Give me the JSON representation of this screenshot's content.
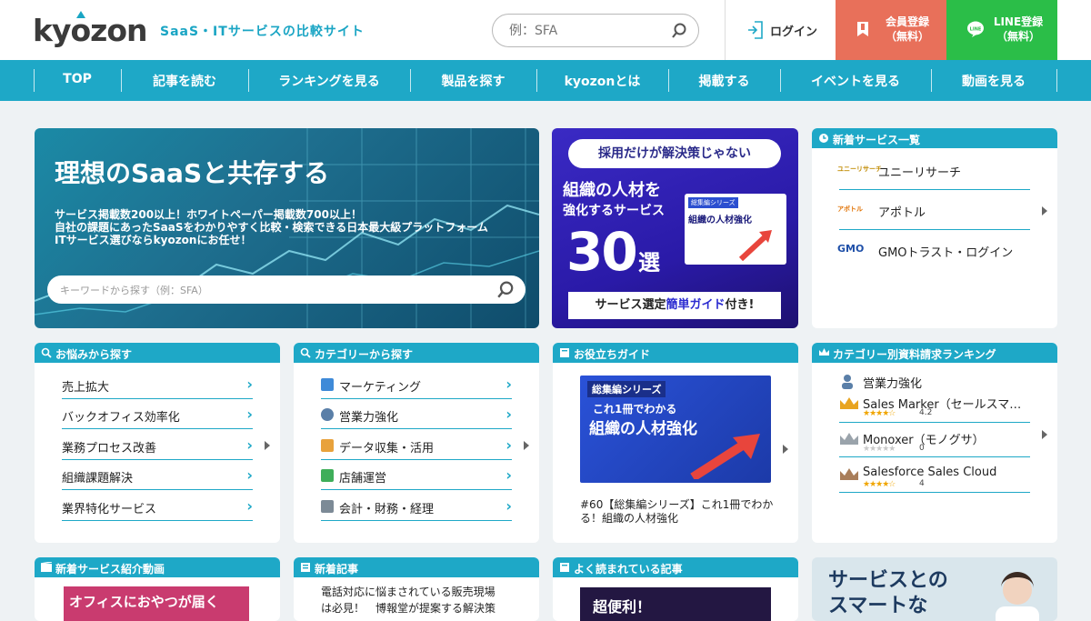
{
  "header": {
    "logo": "kyozon",
    "tagline": "SaaS・ITサービスの比較サイト",
    "search_placeholder": "例：SFA",
    "login_label": "ログイン",
    "member_label": "会員登録",
    "member_sub": "（無料）",
    "line_label": "LINE登録",
    "line_sub": "（無料）",
    "colors": {
      "accent": "#1ea8c7",
      "member": "#e8705a",
      "line": "#2bbe48"
    }
  },
  "nav": {
    "items": [
      "TOP",
      "記事を読む",
      "ランキングを見る",
      "製品を探す",
      "kyozonとは",
      "掲載する",
      "イベントを見る",
      "動画を見る"
    ]
  },
  "hero": {
    "title": "理想のSaaSと共存する",
    "desc1": "サービス掲載数200以上！ホワイトペーパー掲載数700以上！",
    "desc2": "自社の課題にあったSaaSをわかりやすく比較・検索できる日本最大級プラットフォーム",
    "desc3": "ITサービス選びならkyozonにお任せ！",
    "search_placeholder": "キーワードから探す（例：SFA）"
  },
  "promo": {
    "pill": "採用だけが解決策じゃない",
    "line1": "組織の人材を",
    "line2": "強化するサービス",
    "number": "30",
    "unit": "選",
    "bar_prefix": "サービス選定",
    "bar_highlight": "簡単ガイド",
    "bar_suffix": "付き!",
    "book_series": "総集編シリーズ",
    "book_title": "組織の人材強化"
  },
  "new_services": {
    "header": "新着サービス一覧",
    "items": [
      {
        "logo": "ユニーリサーチ",
        "name": "ユニーリサーチ"
      },
      {
        "logo": "アポトル",
        "name": "アポトル"
      },
      {
        "logo": "GMO",
        "name": "GMOトラスト・ログイン"
      }
    ]
  },
  "worries": {
    "header": "お悩みから探す",
    "items": [
      "売上拡大",
      "バックオフィス効率化",
      "業務プロセス改善",
      "組織課題解決",
      "業界特化サービス"
    ]
  },
  "categories": {
    "header": "カテゴリーから探す",
    "items": [
      "マーケティング",
      "営業力強化",
      "データ収集・活用",
      "店舗運営",
      "会計・財務・経理"
    ]
  },
  "guide": {
    "header": "お役立ちガイド",
    "series": "総集編シリーズ",
    "catch": "これ1冊でわかる",
    "book_title": "組織の人材強化",
    "caption": "#60【総集編シリーズ】これ1冊でわかる！組織の人材強化"
  },
  "ranking": {
    "header": "カテゴリー別資料請求ランキング",
    "category": "営業力強化",
    "items": [
      {
        "name": "Sales Marker（セールスマ…",
        "score": "4.2"
      },
      {
        "name": "Monoxer（モノグサ）",
        "score": "0"
      },
      {
        "name": "Salesforce Sales Cloud",
        "score": "4"
      }
    ]
  },
  "bottom": {
    "videos_header": "新着サービス紹介動画",
    "videos_thumb": "オフィスにおやつが届く",
    "articles_header": "新着記事",
    "article1": "電話対応に悩まされている販売現場",
    "article2": "は必見！　博報堂が提案する解決策",
    "popular_header": "よく読まれている記事",
    "popular_thumb": "超便利！",
    "ad_line1": "サービスとの",
    "ad_line2": "スマートな"
  }
}
